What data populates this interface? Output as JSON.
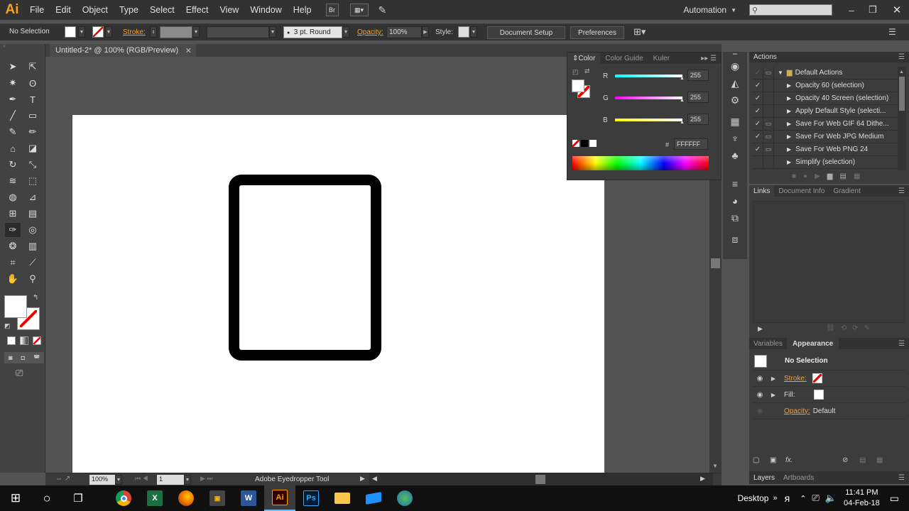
{
  "app": {
    "logo": "Ai",
    "workspace": "Automation",
    "search_placeholder": ""
  },
  "menu": [
    "File",
    "Edit",
    "Object",
    "Type",
    "Select",
    "Effect",
    "View",
    "Window",
    "Help"
  ],
  "toolbar_icons": {
    "bridge": "Br"
  },
  "control": {
    "selection": "No Selection",
    "stroke_label": "Stroke:",
    "brush": "3 pt. Round",
    "opacity_label": "Opacity:",
    "opacity_value": "100%",
    "style_label": "Style:",
    "doc_setup": "Document Setup",
    "preferences": "Preferences"
  },
  "document": {
    "tab_title": "Untitled-2* @ 100% (RGB/Preview)"
  },
  "color_panel": {
    "tabs": [
      "Color",
      "Color Guide",
      "Kuler"
    ],
    "r_label": "R",
    "g_label": "G",
    "b_label": "B",
    "r": "255",
    "g": "255",
    "b": "255",
    "hex_label": "#",
    "hex": "FFFFFF"
  },
  "actions_panel": {
    "title": "Actions",
    "set_name": "Default Actions",
    "items": [
      "Opacity 60 (selection)",
      "Opacity 40 Screen (selection)",
      "Apply Default Style (selecti...",
      "Save For Web GIF 64 Dithe...",
      "Save For Web JPG Medium",
      "Save For Web PNG 24",
      "Simplify (selection)"
    ]
  },
  "links_panel": {
    "tabs": [
      "Links",
      "Document Info",
      "Gradient"
    ]
  },
  "appearance_panel": {
    "tabs": [
      "Variables",
      "Appearance"
    ],
    "header": "No Selection",
    "stroke_label": "Stroke:",
    "fill_label": "Fill:",
    "opacity_label": "Opacity:",
    "opacity_value": "Default"
  },
  "bottom_tabs": [
    "Layers",
    "Artboards"
  ],
  "status": {
    "zoom": "100%",
    "artboard": "1",
    "tool": "Adobe Eyedropper Tool"
  },
  "taskbar": {
    "desktop": "Desktop",
    "time": "11:41 PM",
    "date": "04-Feb-18",
    "apps": [
      "chrome",
      "excel",
      "firefox",
      "video",
      "word",
      "illustrator",
      "photoshop",
      "explorer",
      "app1",
      "app2"
    ]
  }
}
